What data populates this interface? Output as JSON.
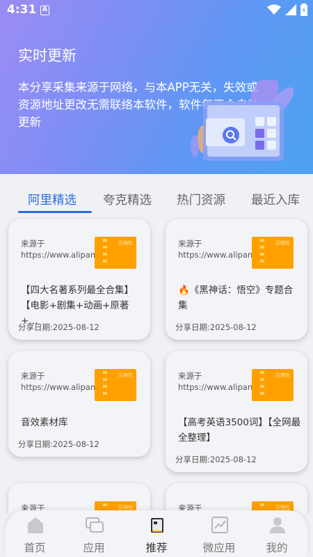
{
  "status": {
    "time": "4:31",
    "notify": "A"
  },
  "hero": {
    "title": "实时更新",
    "description": "本分享采集来源于网络，与本APP无关，失效或资源地址更改无需联络本软件，软件每天会自动更新"
  },
  "tabs": [
    {
      "label": "阿里精选",
      "active": true
    },
    {
      "label": "夸克精选",
      "active": false
    },
    {
      "label": "热门资源",
      "active": false
    },
    {
      "label": "最近入库",
      "active": false
    }
  ],
  "cards": [
    {
      "source": "来源于https://www.alipan.com/",
      "title": "【四大名著系列最全合集】【电影+剧集+动画+原著+…",
      "date": "分享日期:2025-08-12",
      "thumb_label": "压缩包"
    },
    {
      "source": "来源于https://www.alipan.com/",
      "title": "🔥《黑神话：悟空》专题合集",
      "date": "分享日期:2025-08-12",
      "thumb_label": "压缩包"
    },
    {
      "source": "来源于https://www.alipan.com/",
      "title": "音效素材库",
      "date": "分享日期:2025-08-12",
      "thumb_label": "压缩包"
    },
    {
      "source": "来源于https://www.alipan.com/",
      "title": "【高考英语3500词】【全网最全整理】",
      "date": "分享日期:2025-08-12",
      "thumb_label": "压缩包"
    },
    {
      "source": "来源于",
      "title": "",
      "date": "",
      "thumb_label": "压缩包"
    },
    {
      "source": "来源于",
      "title": "",
      "date": "",
      "thumb_label": "压缩包"
    }
  ],
  "nav": [
    {
      "label": "首页",
      "icon": "home-icon",
      "active": false
    },
    {
      "label": "应用",
      "icon": "apps-icon",
      "active": false
    },
    {
      "label": "推荐",
      "icon": "recommend-icon",
      "active": true
    },
    {
      "label": "微应用",
      "icon": "chart-icon",
      "active": false
    },
    {
      "label": "我的",
      "icon": "user-icon",
      "active": false
    }
  ],
  "colors": {
    "accent": "#2b6de0",
    "thumb": "#ffa000",
    "hero_start": "#9b8cf4",
    "hero_end": "#4ea3f0"
  }
}
